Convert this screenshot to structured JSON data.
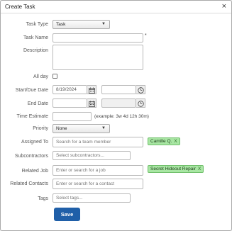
{
  "dialog": {
    "title": "Create Task",
    "close_label": "×"
  },
  "fields": {
    "task_type": {
      "label": "Task Type",
      "value": "Task"
    },
    "task_name": {
      "label": "Task Name",
      "value": "",
      "required_mark": "*"
    },
    "description": {
      "label": "Description",
      "value": ""
    },
    "all_day": {
      "label": "All day",
      "checked": false
    },
    "start_due_date": {
      "label": "Start/Due Date",
      "date": "8/19/2024",
      "time": ""
    },
    "end_date": {
      "label": "End Date",
      "date": "",
      "time": ""
    },
    "time_estimate": {
      "label": "Time Estimate",
      "value": "",
      "hint": "(example: 3w 4d 12h 30m)"
    },
    "priority": {
      "label": "Priority",
      "value": "None"
    },
    "assigned_to": {
      "label": "Assigned To",
      "placeholder": "Search for a team member",
      "tag": "Camille Q.",
      "tag_remove": "X"
    },
    "subcontractors": {
      "label": "Subcontractors",
      "placeholder": "Select subcontractors..."
    },
    "related_job": {
      "label": "Related Job",
      "placeholder": "Enter or search for a job",
      "tag": "Secret Hideout Repair",
      "tag_remove": "X"
    },
    "related_contacts": {
      "label": "Related Contacts",
      "placeholder": "Enter or search for a contact"
    },
    "tags": {
      "label": "Tags",
      "placeholder": "Select tags..."
    }
  },
  "actions": {
    "save_label": "Save"
  },
  "icons": {
    "close": "close-icon",
    "calendar": "calendar-icon",
    "clock": "clock-icon",
    "dropdown": "chevron-down-icon"
  },
  "colors": {
    "save_button": "#1f5fa8",
    "tag_background": "#a8e6a3"
  }
}
